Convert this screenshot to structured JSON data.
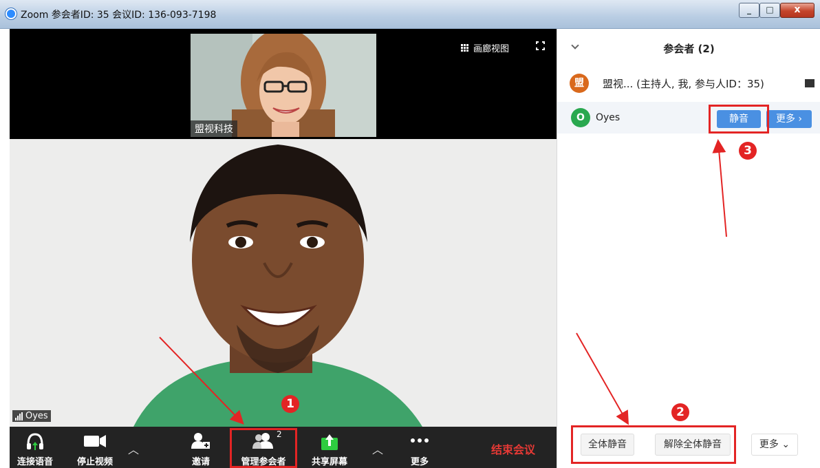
{
  "window": {
    "title": "Zoom 参会者ID: 35   会议ID: 136-093-7198",
    "controls": {
      "minimize": "_",
      "maximize": "□",
      "close": "x"
    }
  },
  "video": {
    "gallery_view_label": "画廊视图",
    "thumbnail_name": "盟视科技",
    "speaker_name": "Oyes"
  },
  "toolbar": {
    "join_audio": "连接语音",
    "stop_video": "停止视频",
    "invite": "邀请",
    "manage_participants": "管理参会者",
    "participant_count": "2",
    "share_screen": "共享屏幕",
    "more": "更多",
    "end_meeting": "结束会议"
  },
  "panel": {
    "title": "参会者 (2)",
    "participants": [
      {
        "avatar": "盟",
        "name": "盟视...  (主持人, 我, 参与人ID：35)",
        "avatar_color": "#d9691c"
      },
      {
        "avatar": "O",
        "name": "Oyes",
        "avatar_color": "#2aa84f",
        "mute_label": "静音",
        "more_label": "更多 ›"
      }
    ],
    "mute_all": "全体静音",
    "unmute_all": "解除全体静音",
    "more": "更多 ⌄"
  },
  "annotations": {
    "step1": "1",
    "step2": "2",
    "step3": "3"
  }
}
